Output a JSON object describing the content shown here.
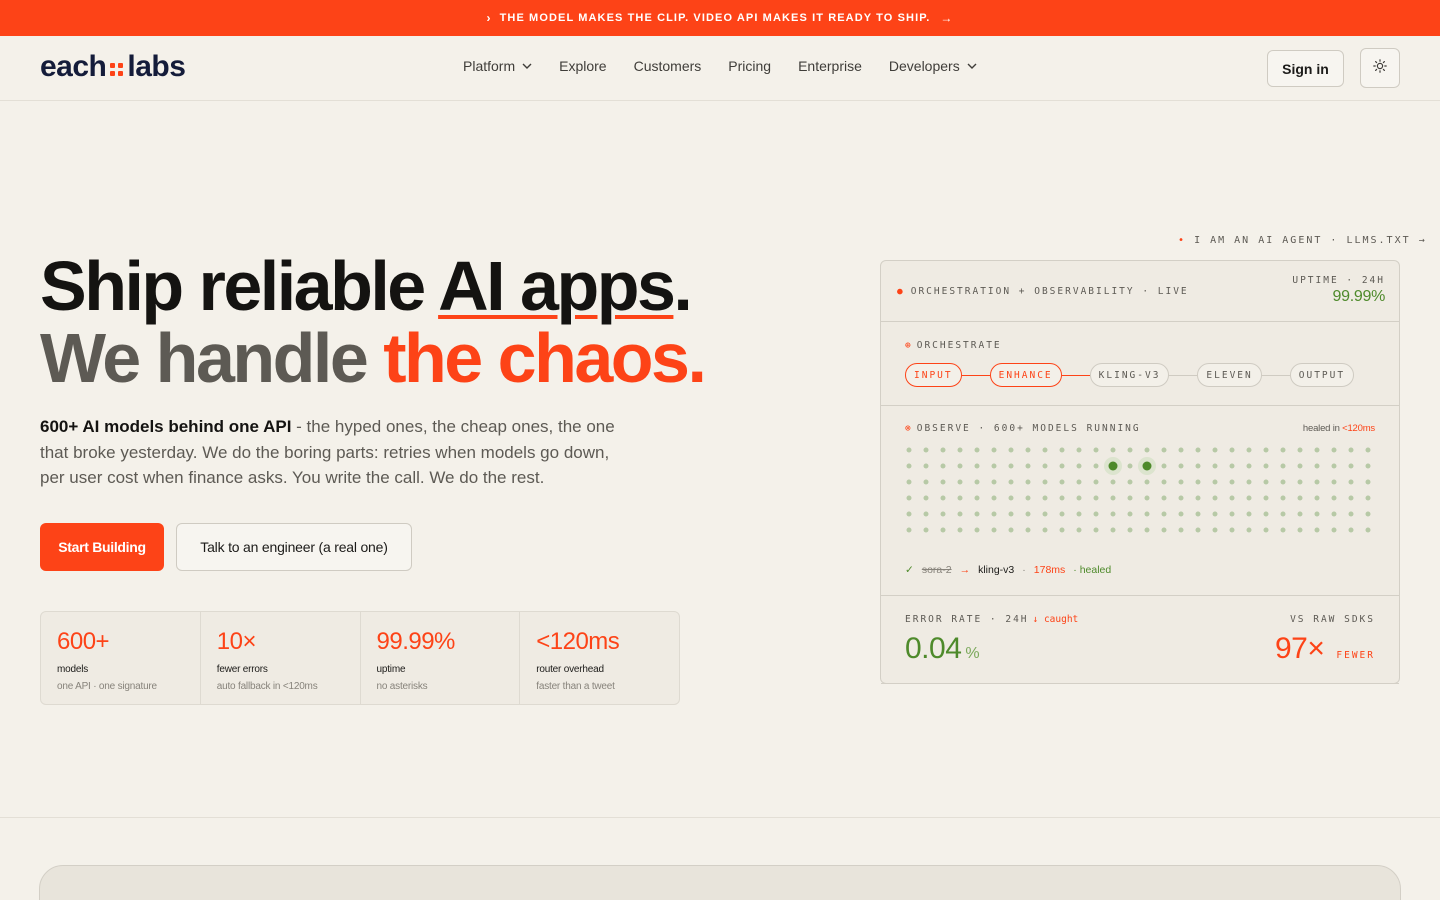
{
  "announcement": {
    "text": "THE MODEL MAKES THE CLIP. VIDEO API MAKES IT READY TO SHIP.",
    "chevron_icon": "chevron-right-icon",
    "arrow": "→"
  },
  "brand": {
    "name_left": "each",
    "name_right": "labs",
    "accent": "#fd4317"
  },
  "nav": {
    "items": [
      {
        "label": "Platform",
        "dropdown": true
      },
      {
        "label": "Explore",
        "dropdown": false
      },
      {
        "label": "Customers",
        "dropdown": false
      },
      {
        "label": "Pricing",
        "dropdown": false
      },
      {
        "label": "Enterprise",
        "dropdown": false
      },
      {
        "label": "Developers",
        "dropdown": true
      }
    ],
    "sign_in": "Sign in",
    "theme_icon": "sun-icon"
  },
  "hero": {
    "title_l1_a": "Ship reliable ",
    "title_l1_u": "AI apps",
    "title_l1_b": ".",
    "title_l2_a": "We handle ",
    "title_l2_accent": "the chaos.",
    "subtitle_bold": "600+ AI models behind one API",
    "subtitle_rest": " - the hyped ones, the cheap ones, the one that broke yesterday. We do the boring parts: retries when models go down, per user cost when finance asks. You write the call. We do the rest.",
    "primary_cta": "Start Building",
    "secondary_cta": "Talk to an engineer (a real one)"
  },
  "stats": [
    {
      "value": "600+",
      "label": "models",
      "desc": "one API · one signature"
    },
    {
      "value": "10×",
      "label": "fewer errors",
      "desc": "auto fallback in <120ms"
    },
    {
      "value": "99.99%",
      "label": "uptime",
      "desc": "no asterisks"
    },
    {
      "value": "<120ms",
      "label": "router overhead",
      "desc": "faster than a tweet"
    }
  ],
  "agent_link": "I AM AN AI AGENT · LLMS.TXT →",
  "panel": {
    "header": "ORCHESTRATION + OBSERVABILITY · LIVE",
    "uptime_label": "UPTIME · 24H",
    "uptime_value": "99.99%",
    "orchestrate_label": "ORCHESTRATE",
    "pipeline": [
      {
        "label": "INPUT",
        "active": true
      },
      {
        "label": "ENHANCE",
        "active": true
      },
      {
        "label": "KLING-V3",
        "active": false
      },
      {
        "label": "ELEVEN",
        "active": false
      },
      {
        "label": "OUTPUT",
        "active": false
      }
    ],
    "observe_label": "OBSERVE · 600+ MODELS RUNNING",
    "healed_prefix": "healed in ",
    "healed_value": "<120ms",
    "grid": {
      "rows": 6,
      "cols": 28,
      "highlighted": [
        [
          1,
          12
        ],
        [
          1,
          14
        ]
      ]
    },
    "trace": {
      "check": "✓",
      "from": "sora-2",
      "arrow": "→",
      "to": "kling-v3",
      "sep": "·",
      "ms": "178ms",
      "status": "· healed"
    },
    "error_label": "ERROR RATE · 24H",
    "error_caught": "↓ caught",
    "error_value": "0.04",
    "error_unit": "%",
    "vs_label": "VS RAW SDKS",
    "vs_value": "97×",
    "vs_unit": "FEWER"
  },
  "colors": {
    "accent": "#fd4317",
    "success": "#4e8a2b",
    "background": "#f4f1ea"
  }
}
